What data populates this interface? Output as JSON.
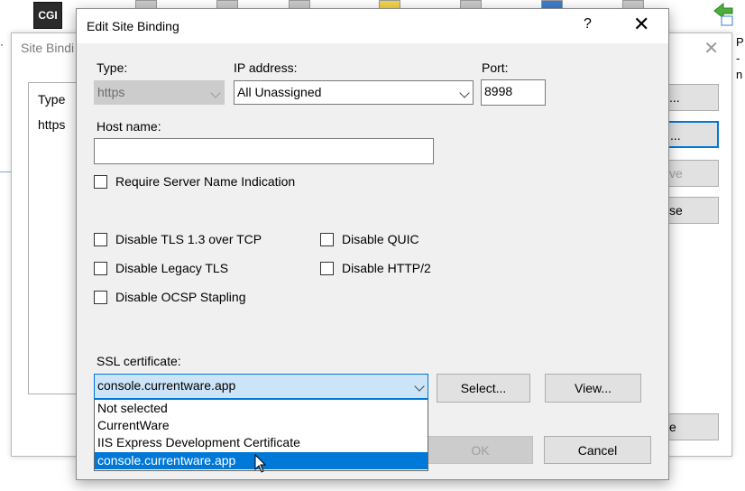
{
  "desktop": {
    "cgi_icon_label": "CGI",
    "right_partial_text": "P\n-\nn"
  },
  "site_bindings": {
    "title": "Site Bindi",
    "list_header": "Type",
    "list_row": "https",
    "buttons": [
      {
        "label": "..."
      },
      {
        "label": "..."
      },
      {
        "label": "ve"
      },
      {
        "label": "se"
      },
      {
        "label": "e"
      }
    ]
  },
  "edit_dialog": {
    "title": "Edit Site Binding",
    "help_glyph": "?",
    "close_glyph": "✕",
    "type": {
      "label": "Type:",
      "value": "https"
    },
    "ip": {
      "label": "IP address:",
      "value": "All Unassigned"
    },
    "port": {
      "label": "Port:",
      "value": "8998"
    },
    "host": {
      "label": "Host name:",
      "value": ""
    },
    "sni_checkbox": "Require Server Name Indication",
    "checkboxes_left": [
      "Disable TLS 1.3 over TCP",
      "Disable Legacy TLS",
      "Disable OCSP Stapling"
    ],
    "checkboxes_right": [
      "Disable QUIC",
      "Disable HTTP/2"
    ],
    "ssl": {
      "label": "SSL certificate:",
      "value": "console.currentware.app",
      "options": [
        "Not selected",
        "CurrentWare",
        "IIS Express Development Certificate",
        "console.currentware.app"
      ],
      "selected_index": 3
    },
    "select_button": "Select...",
    "view_button": "View...",
    "ok_button": "OK",
    "cancel_button": "Cancel"
  },
  "colors": {
    "accent": "#0078d7",
    "dialog_bg": "#f0f0f0",
    "selection": "#0078d7"
  }
}
